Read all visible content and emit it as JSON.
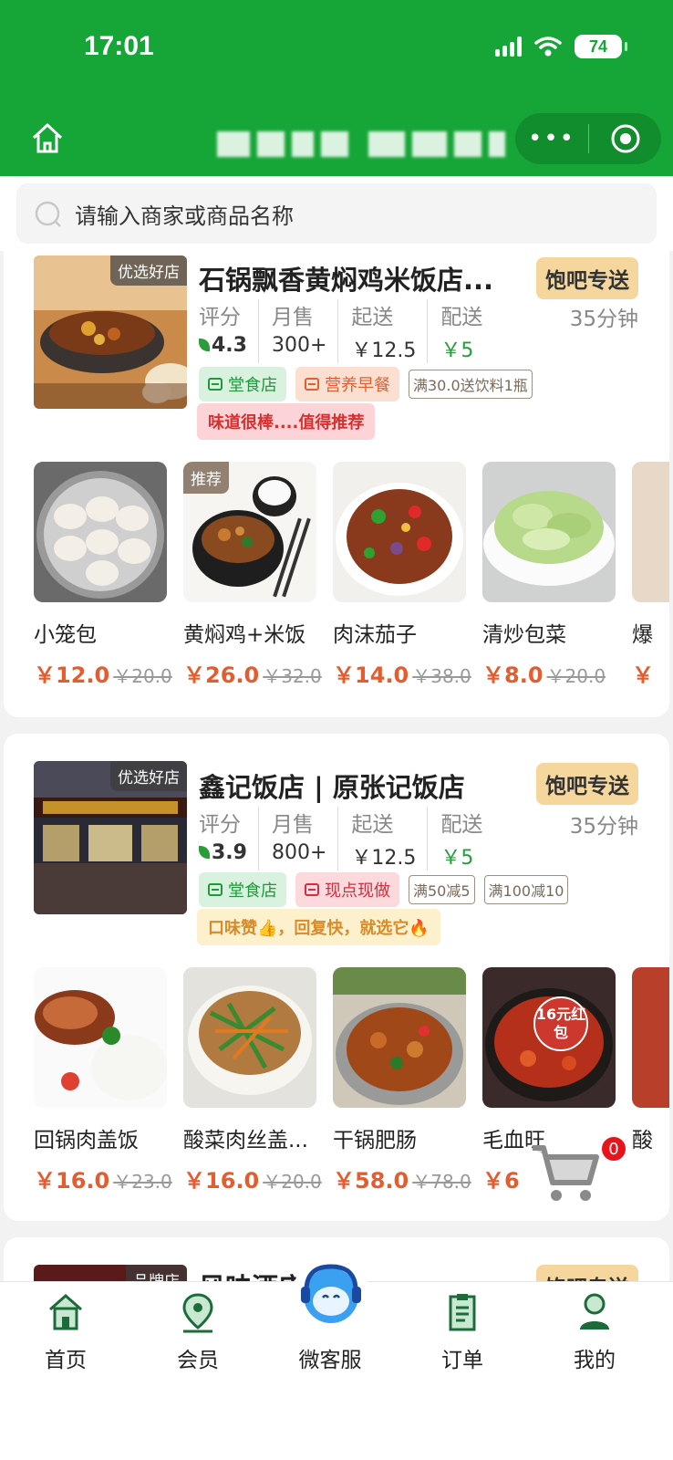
{
  "status": {
    "time": "17:01",
    "battery": "74"
  },
  "search": {
    "placeholder": "请输入商家或商品名称"
  },
  "stores": [
    {
      "tag": "优选好店",
      "name": "石锅飘香黄焖鸡米饭店...",
      "badge": "饱吧专送",
      "stats": [
        {
          "k": "评分",
          "v": "4.3"
        },
        {
          "k": "月售",
          "v": "300+"
        },
        {
          "k": "起送",
          "v": "￥12.5"
        },
        {
          "k": "配送",
          "v": "￥5"
        }
      ],
      "eta": "35分钟",
      "tags": [
        "堂食店",
        "营养早餐"
      ],
      "promos": [
        "满30.0送饮料1瓶"
      ],
      "slogan": "味道很棒....值得推荐",
      "dishes": [
        {
          "name": "小笼包",
          "price": "￥12.0",
          "was": "￥20.0"
        },
        {
          "name": "黄焖鸡+米饭",
          "price": "￥26.0",
          "was": "￥32.0",
          "tag": "推荐"
        },
        {
          "name": "肉沫茄子",
          "price": "￥14.0",
          "was": "￥38.0"
        },
        {
          "name": "清炒包菜",
          "price": "￥8.0",
          "was": "￥20.0"
        },
        {
          "name": "爆",
          "price": "￥",
          "was": ""
        }
      ]
    },
    {
      "tag": "优选好店",
      "name": "鑫记饭店 | 原张记饭店",
      "badge": "饱吧专送",
      "stats": [
        {
          "k": "评分",
          "v": "3.9"
        },
        {
          "k": "月售",
          "v": "800+"
        },
        {
          "k": "起送",
          "v": "￥12.5"
        },
        {
          "k": "配送",
          "v": "￥5"
        }
      ],
      "eta": "35分钟",
      "tags": [
        "堂食店",
        "现点现做"
      ],
      "promos": [
        "满50减5",
        "满100减10"
      ],
      "slogan": "口味赞👍，回复快，就选它🔥",
      "dishes": [
        {
          "name": "回锅肉盖饭",
          "price": "￥16.0",
          "was": "￥23.0"
        },
        {
          "name": "酸菜肉丝盖...",
          "price": "￥16.0",
          "was": "￥20.0"
        },
        {
          "name": "干锅肥肠",
          "price": "￥58.0",
          "was": "￥78.0"
        },
        {
          "name": "毛血旺",
          "price": "￥6",
          "was": "",
          "img_text": "16元红包"
        },
        {
          "name": "酸",
          "price": "",
          "was": ""
        }
      ]
    },
    {
      "tag": "品牌店",
      "name": "风味酒店",
      "badge": "饱吧专送"
    }
  ],
  "cart": {
    "count": "0"
  },
  "nav": [
    {
      "label": "首页"
    },
    {
      "label": "会员"
    },
    {
      "label": "微客服"
    },
    {
      "label": "订单"
    },
    {
      "label": "我的"
    }
  ],
  "colors": {
    "brand": "#16a637",
    "price": "#e55d2f",
    "badge": "#f5d79e"
  }
}
